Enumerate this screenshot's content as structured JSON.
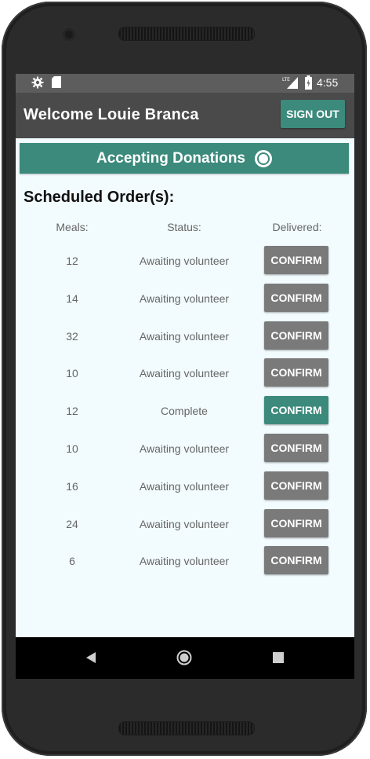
{
  "status_bar": {
    "time": "4:55",
    "left_icons": [
      "gear-icon",
      "sd-card-icon"
    ],
    "right_icons": [
      "lte-signal-icon",
      "battery-icon"
    ]
  },
  "app_bar": {
    "title": "Welcome Louie Branca",
    "sign_out_label": "SIGN OUT"
  },
  "donations": {
    "label": "Accepting Donations",
    "toggle_on": true
  },
  "orders": {
    "section_title": "Scheduled Order(s):",
    "headers": {
      "meals": "Meals:",
      "status": "Status:",
      "delivered": "Delivered:"
    },
    "rows": [
      {
        "meals": "12",
        "status": "Awaiting volunteer",
        "action": "CONFIRM",
        "active": false
      },
      {
        "meals": "14",
        "status": "Awaiting volunteer",
        "action": "CONFIRM",
        "active": false
      },
      {
        "meals": "32",
        "status": "Awaiting volunteer",
        "action": "CONFIRM",
        "active": false
      },
      {
        "meals": "10",
        "status": "Awaiting volunteer",
        "action": "CONFIRM",
        "active": false
      },
      {
        "meals": "12",
        "status": "Complete",
        "action": "CONFIRM",
        "active": true
      },
      {
        "meals": "10",
        "status": "Awaiting volunteer",
        "action": "CONFIRM",
        "active": false
      },
      {
        "meals": "16",
        "status": "Awaiting volunteer",
        "action": "CONFIRM",
        "active": false
      },
      {
        "meals": "24",
        "status": "Awaiting volunteer",
        "action": "CONFIRM",
        "active": false
      },
      {
        "meals": "6",
        "status": "Awaiting volunteer",
        "action": "CONFIRM",
        "active": false
      }
    ]
  },
  "colors": {
    "accent": "#3c8a7c",
    "button_inactive": "#7a7a7a",
    "app_bar": "#4a4a4a",
    "background": "#f2fbfe"
  },
  "nav_bar": {
    "icons": [
      "back-icon",
      "home-icon",
      "recents-icon"
    ]
  }
}
